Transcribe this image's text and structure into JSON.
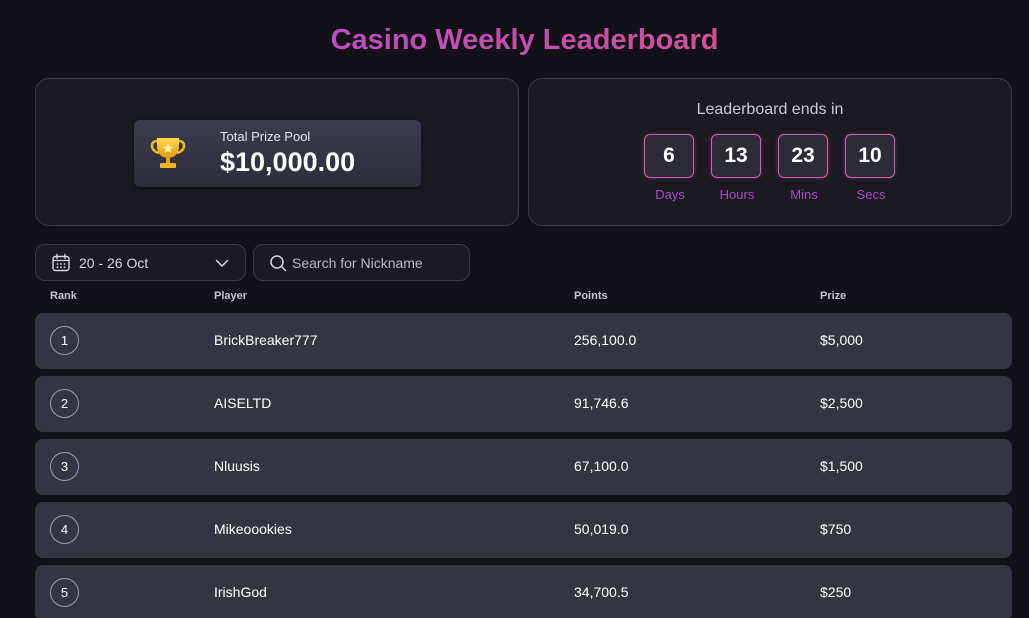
{
  "title": "Casino Weekly Leaderboard",
  "prize_pool": {
    "label": "Total Prize Pool",
    "value": "$10,000.00",
    "icon": "trophy-icon"
  },
  "countdown": {
    "title": "Leaderboard ends in",
    "units": [
      {
        "value": "6",
        "label": "Days"
      },
      {
        "value": "13",
        "label": "Hours"
      },
      {
        "value": "23",
        "label": "Mins"
      },
      {
        "value": "10",
        "label": "Secs"
      }
    ]
  },
  "filters": {
    "date_range": "20 - 26 Oct",
    "search_placeholder": "Search for Nickname",
    "search_value": ""
  },
  "table": {
    "headers": {
      "rank": "Rank",
      "player": "Player",
      "points": "Points",
      "prize": "Prize"
    },
    "rows": [
      {
        "rank": "1",
        "player": "BrickBreaker777",
        "points": "256,100.0",
        "prize": "$5,000"
      },
      {
        "rank": "2",
        "player": "AISELTD",
        "points": "91,746.6",
        "prize": "$2,500"
      },
      {
        "rank": "3",
        "player": "Nluusis",
        "points": "67,100.0",
        "prize": "$1,500"
      },
      {
        "rank": "4",
        "player": "Mikeoookies",
        "points": "50,019.0",
        "prize": "$750"
      },
      {
        "rank": "5",
        "player": "IrishGod",
        "points": "34,700.5",
        "prize": "$250"
      }
    ]
  },
  "colors": {
    "background": "#121117",
    "card": "#1b1a22",
    "row": "#343544",
    "accent_purple": "#b04be0",
    "accent_pink": "#e95474",
    "timer_label": "#a64fc4"
  }
}
